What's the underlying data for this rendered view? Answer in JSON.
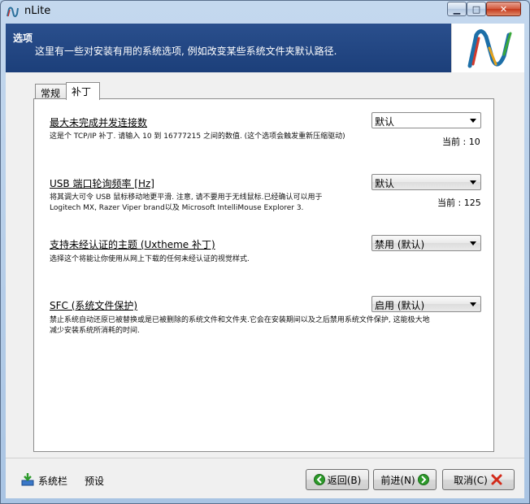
{
  "window": {
    "title": "nLite",
    "minimize_glyph": "▁",
    "maximize_glyph": "□",
    "close_glyph": "✕"
  },
  "header": {
    "title": "选项",
    "subtitle": "这里有一些对安装有用的系统选项, 例如改变某些系统文件夹默认路径."
  },
  "tabs": [
    {
      "label": "常规"
    },
    {
      "label": "补丁"
    }
  ],
  "options": [
    {
      "title": "最大未完成并发连接数",
      "description_lines": [
        "这是个 TCP/IP 补丁. 请输入 10 到 16777215 之间的数值. (这个选项会触发重新压缩驱动)"
      ],
      "value": "默认",
      "current": "当前 : 10"
    },
    {
      "title": "USB 端口轮询频率 [Hz]",
      "description_lines": [
        "将其调大可令 USB 鼠标移动地更平滑. 注意, 请不要用于无线鼠标.已经确认可以用于",
        "Logitech MX, Razer Viper brand以及 Microsoft IntelliMouse Explorer 3."
      ],
      "value": "默认",
      "current": "当前 : 125"
    },
    {
      "title": "支持未经认证的主题 (Uxtheme 补丁)",
      "description_lines": [
        "选择这个将能让你使用从网上下载的任何未经认证的视觉样式."
      ],
      "value": "禁用 (默认)"
    },
    {
      "title": "SFC (系统文件保护)",
      "description_lines": [
        "禁止系统自动还原已被替换或是已被删除的系统文件和文件夹.它会在安装期间以及之后禁用系统文件保护, 这能极大地",
        "减少安装系统所消耗的时间."
      ],
      "value": "启用 (默认)"
    }
  ],
  "footer": {
    "sys_label": "系统栏",
    "preset_label": "预设",
    "back_label": "返回(B)",
    "next_label": "前进(N)",
    "cancel_label": "取消(C)"
  },
  "colors": {
    "header_bg": "#1c3f7a",
    "accent_green": "#2c9a2a",
    "cancel_red": "#d22a1a"
  },
  "icons": [
    "nlite-logo-icon",
    "system-tray-icon",
    "back-arrow-icon",
    "next-arrow-icon",
    "cancel-x-icon"
  ]
}
